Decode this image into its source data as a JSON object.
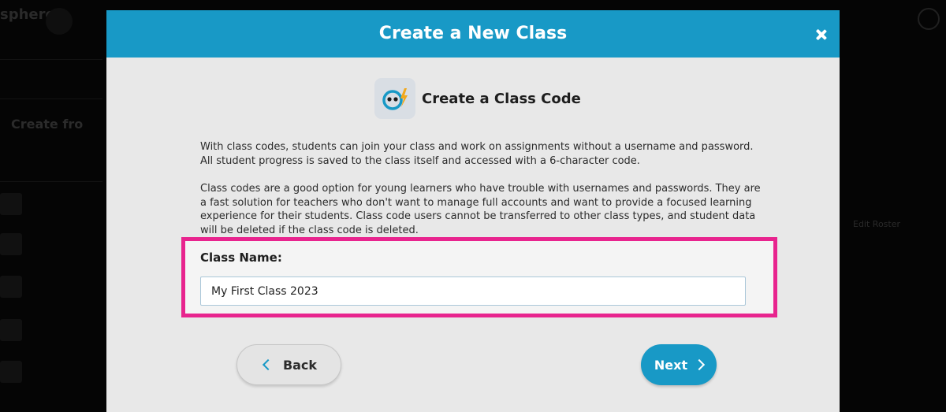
{
  "background": {
    "logo_text": "sphero",
    "sidebar_link": "Create fro",
    "right_label": "Edit Roster"
  },
  "modal": {
    "title": "Create a New Class",
    "section": {
      "icon": "sphero-robot-bolt-icon",
      "title": "Create a Class Code"
    },
    "paragraphs": [
      "With class codes, students can join your class and work on assignments without a username and password. All student progress is saved to the class itself and accessed with a 6-character code.",
      "Class codes are a good option for young learners who have trouble with usernames and passwords. They are a fast solution for teachers who don't want to manage full accounts and want to provide a focused learning experience for their students. Class code users cannot be transferred to other class types, and student data will be deleted if the class code is deleted."
    ],
    "class_name": {
      "label": "Class Name:",
      "value": "My First Class 2023"
    },
    "buttons": {
      "back": "Back",
      "next": "Next"
    }
  },
  "colors": {
    "header": "#1899c6",
    "highlight": "#e8248e",
    "next_button": "#1899c6"
  }
}
